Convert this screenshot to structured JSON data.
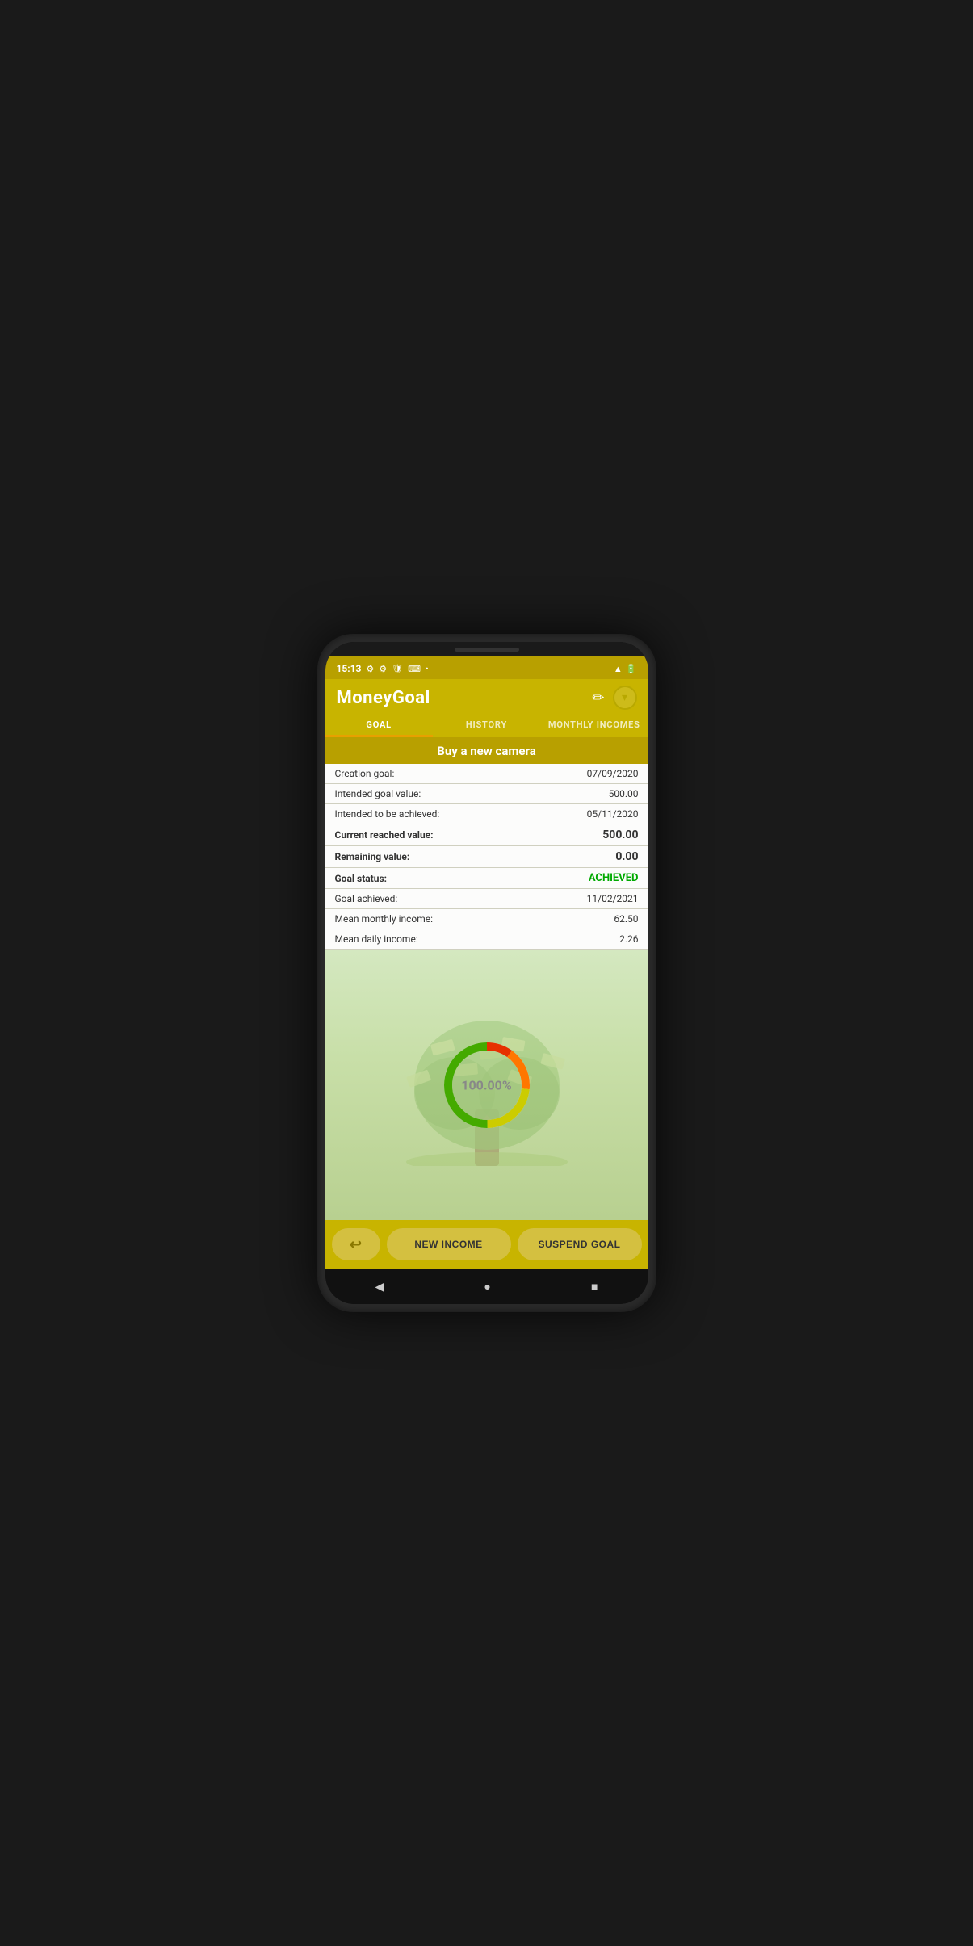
{
  "statusBar": {
    "time": "15:13",
    "icons": [
      "⚙",
      "⚙",
      "🛡",
      "⌨",
      "•"
    ]
  },
  "header": {
    "title": "MoneyGoal",
    "editIcon": "✏",
    "dropdownIcon": "▾"
  },
  "tabs": [
    {
      "label": "GOAL",
      "active": true
    },
    {
      "label": "HISTORY",
      "active": false
    },
    {
      "label": "MONTHLY INCOMES",
      "active": false
    }
  ],
  "goal": {
    "title": "Buy a new camera",
    "rows": [
      {
        "label": "Creation goal:",
        "value": "07/09/2020",
        "bold": false
      },
      {
        "label": "Intended goal value:",
        "value": "500.00",
        "bold": false
      },
      {
        "label": "Intended to be achieved:",
        "value": "05/11/2020",
        "bold": false
      },
      {
        "label": "Current reached value:",
        "value": "500.00",
        "bold": true
      },
      {
        "label": "Remaining value:",
        "value": "0.00",
        "bold": true
      },
      {
        "label": "Goal status:",
        "value": "ACHIEVED",
        "bold": true,
        "valueClass": "achieved"
      },
      {
        "label": "Goal achieved:",
        "value": "11/02/2021",
        "bold": false
      },
      {
        "label": "Mean monthly income:",
        "value": "62.50",
        "bold": false
      },
      {
        "label": "Mean daily income:",
        "value": "2.26",
        "bold": false
      }
    ],
    "progress": {
      "percent": 100.0,
      "display": "100.00%"
    }
  },
  "buttons": {
    "back": "↩",
    "newIncome": "NEW INCOME",
    "suspendGoal": "SUSPEND GOAL"
  },
  "navBar": {
    "back": "◀",
    "home": "●",
    "recent": "■"
  }
}
